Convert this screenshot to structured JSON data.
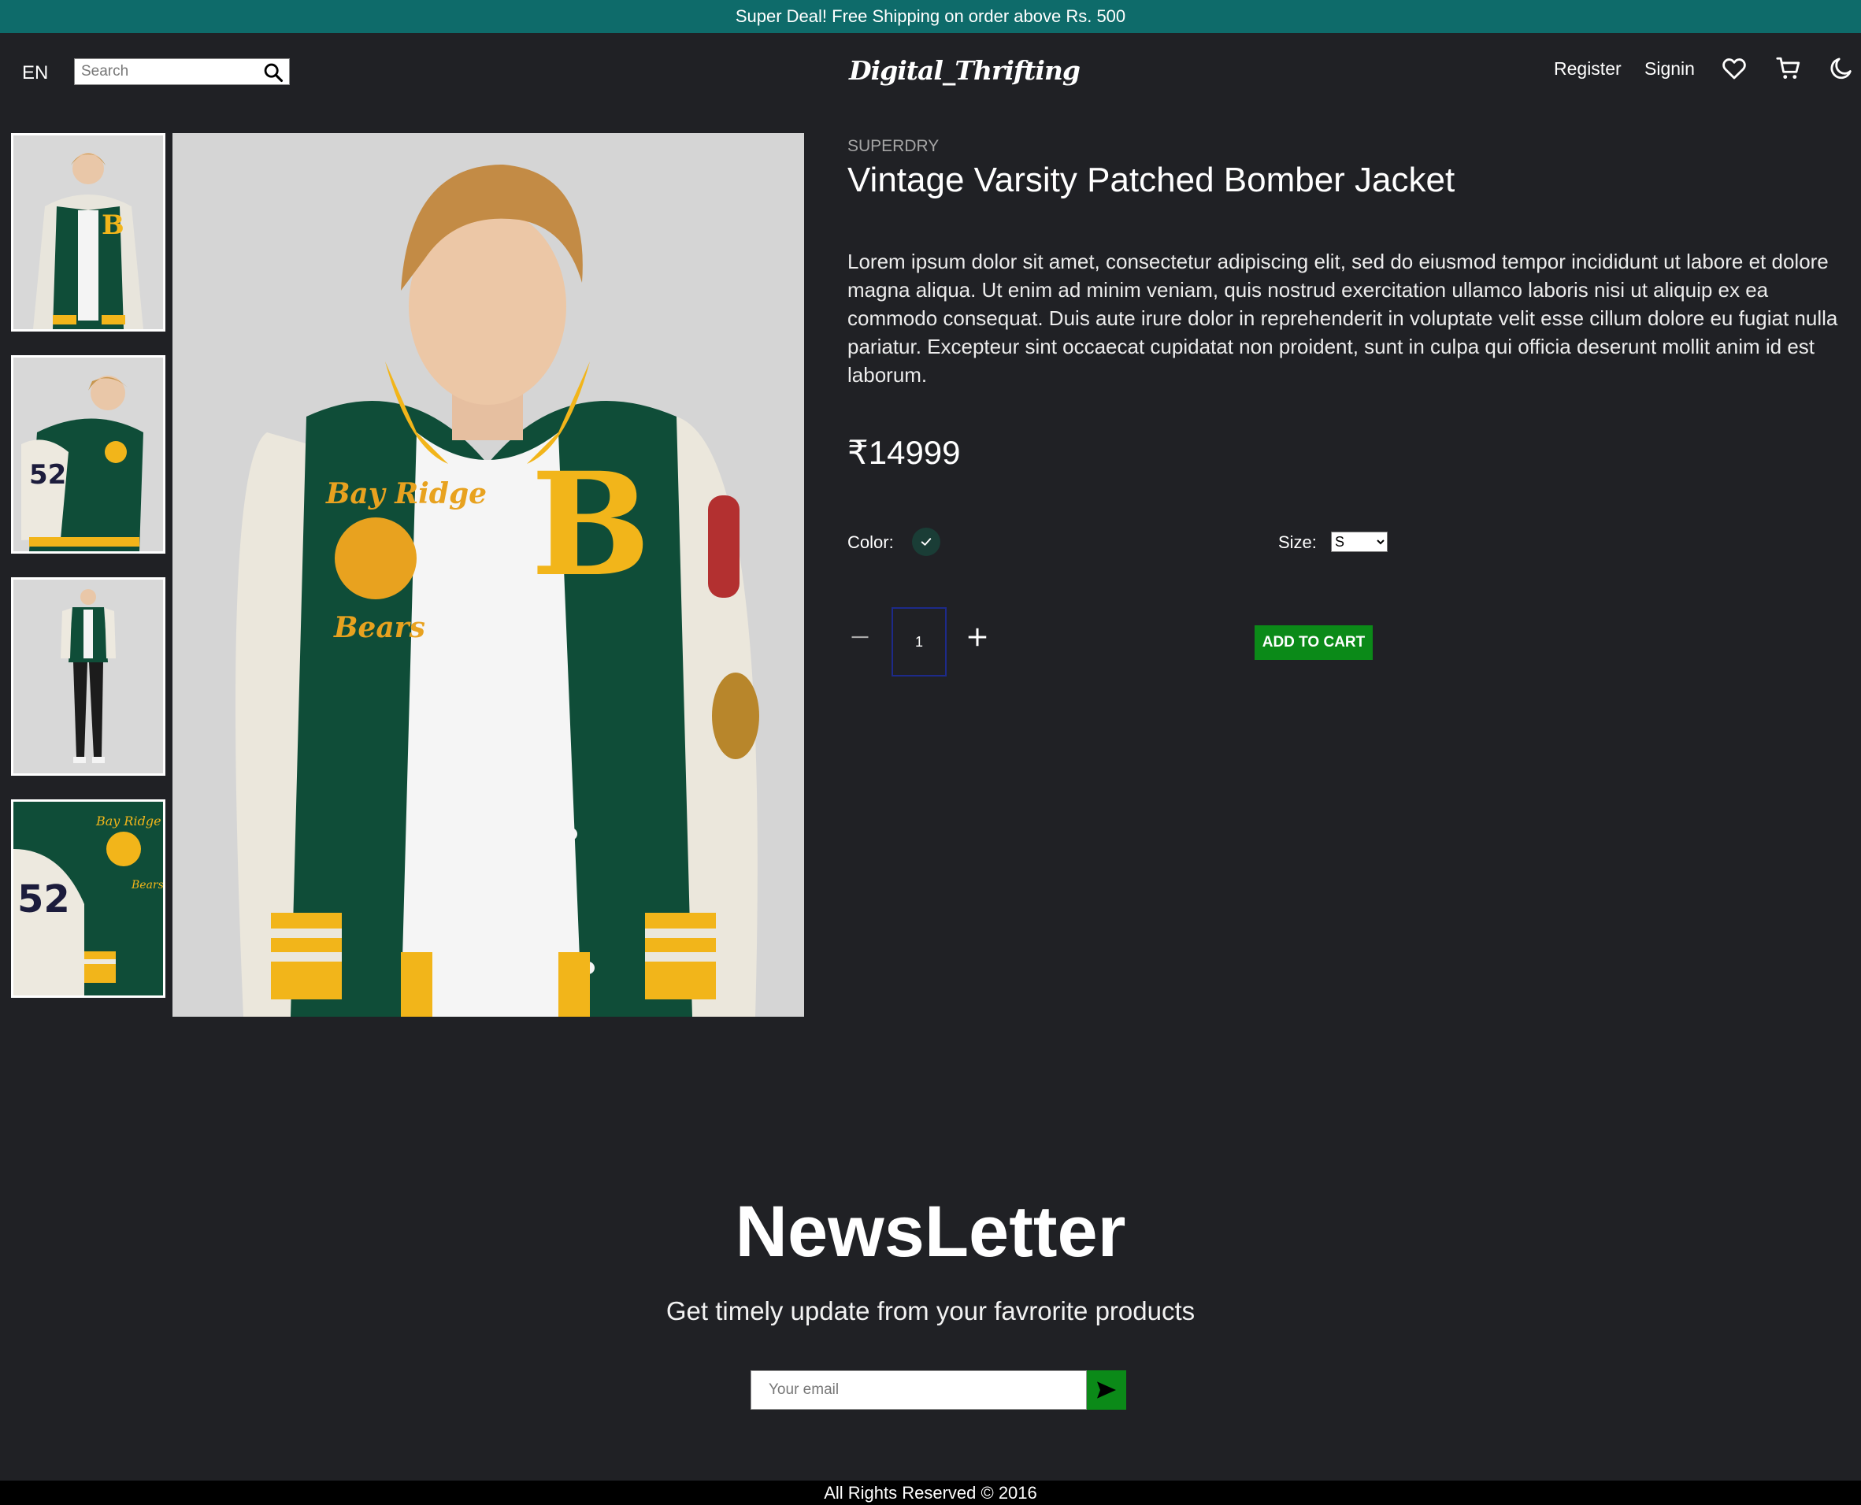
{
  "promo_bar": {
    "text": "Super Deal! Free Shipping on order above Rs. 500"
  },
  "header": {
    "language": "EN",
    "search_placeholder": "Search",
    "logo": "Digital_Thrifting",
    "register_label": "Register",
    "signin_label": "Signin",
    "icons": [
      "search-icon",
      "heart-icon",
      "cart-icon",
      "moon-icon"
    ]
  },
  "product": {
    "brand": "SUPERDRY",
    "title": "Vintage Varsity Patched Bomber Jacket",
    "description": "Lorem ipsum dolor sit amet, consectetur adipiscing elit, sed do eiusmod tempor incididunt ut labore et dolore magna aliqua. Ut enim ad minim veniam, quis nostrud exercitation ullamco laboris nisi ut aliquip ex ea commodo consequat. Duis aute irure dolor in reprehenderit in voluptate velit esse cillum dolore eu fugiat nulla pariatur. Excepteur sint occaecat cupidatat non proident, sunt in culpa qui officia deserunt mollit anim id est laborum.",
    "price": "₹14999",
    "color_label": "Color:",
    "selected_color": "#1a3d36",
    "size_label": "Size:",
    "size_selected": "S",
    "quantity": "1",
    "add_to_cart_label": "ADD TO CART",
    "thumbnail_count": 4
  },
  "newsletter": {
    "title": "NewsLetter",
    "subtitle": "Get timely update from your favrorite products",
    "email_placeholder": "Your email"
  },
  "footer": {
    "text": "All Rights Reserved © 2016"
  },
  "colors": {
    "promo_bg": "#0e6b6a",
    "page_bg": "#202125",
    "button_green": "#0b8a18",
    "jacket_green": "#0f4d38",
    "jacket_yellow": "#f2b51a"
  }
}
